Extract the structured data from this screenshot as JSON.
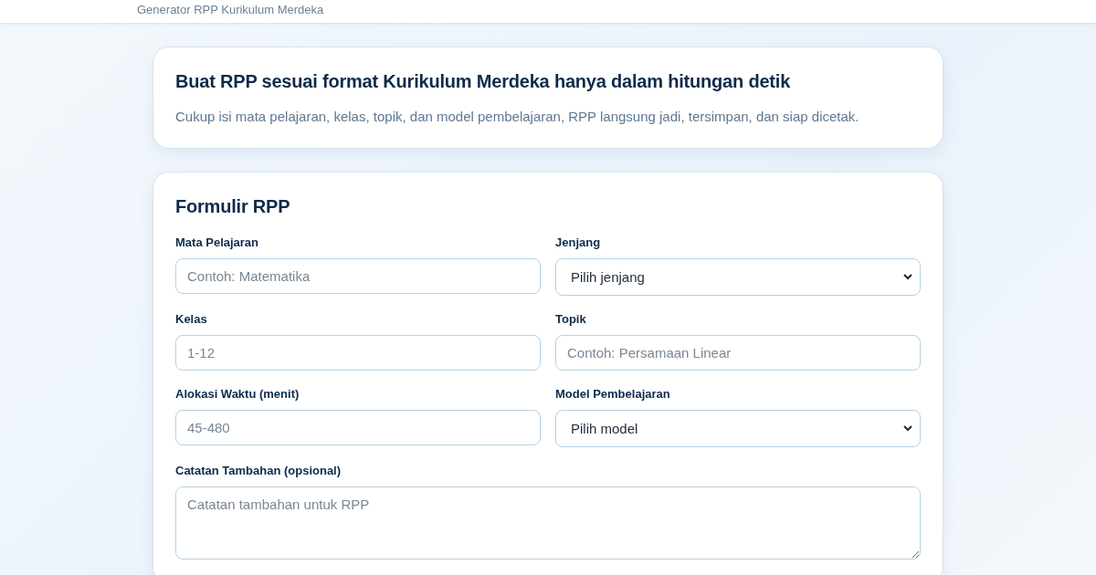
{
  "header": {
    "subtitle": "Generator RPP Kurikulum Merdeka"
  },
  "intro": {
    "title": "Buat RPP sesuai format Kurikulum Merdeka hanya dalam hitungan detik",
    "text": "Cukup isi mata pelajaran, kelas, topik, dan model pembelajaran, RPP langsung jadi, tersimpan, dan siap dicetak."
  },
  "form": {
    "title": "Formulir RPP",
    "fields": [
      {
        "kind": "input",
        "label": "Mata Pelajaran",
        "placeholder": "Contoh: Matematika"
      },
      {
        "kind": "select",
        "label": "Jenjang",
        "value": "Pilih jenjang"
      },
      {
        "kind": "input",
        "label": "Kelas",
        "placeholder": "1-12"
      },
      {
        "kind": "input",
        "label": "Topik",
        "placeholder": "Contoh: Persamaan Linear"
      },
      {
        "kind": "input",
        "label": "Alokasi Waktu (menit)",
        "placeholder": "45-480"
      },
      {
        "kind": "select",
        "label": "Model Pembelajaran",
        "value": "Pilih model"
      },
      {
        "kind": "textarea",
        "label": "Catatan Tambahan (opsional)",
        "placeholder": "Catatan tambahan untuk RPP"
      }
    ]
  }
}
